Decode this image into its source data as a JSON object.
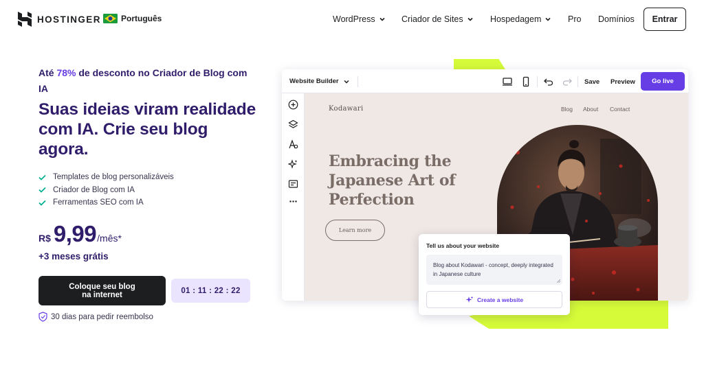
{
  "header": {
    "brand": "HOSTINGER",
    "language": "Português",
    "nav": [
      {
        "label": "WordPress",
        "dropdown": true
      },
      {
        "label": "Criador de Sites",
        "dropdown": true
      },
      {
        "label": "Hospedagem",
        "dropdown": true
      },
      {
        "label": "Pro",
        "dropdown": false
      },
      {
        "label": "Domínios",
        "dropdown": false
      }
    ],
    "login_label": "Entrar"
  },
  "hero": {
    "promo_prefix": "Até ",
    "promo_pct": "78%",
    "promo_suffix": " de desconto no Criador de Blog com IA",
    "headline": "Suas ideias viram realidade com IA. Crie seu blog agora.",
    "features": [
      "Templates de blog personalizáveis",
      "Criador de Blog com IA",
      "Ferramentas SEO com IA"
    ],
    "price": {
      "currency": "R$",
      "amount": "9,99",
      "period": "/mês*"
    },
    "bonus": "+3 meses grátis",
    "cta_label": "Coloque seu blog na internet",
    "timer": "01 : 11 : 22 : 22",
    "refund": "30 dias para pedir reembolso"
  },
  "builder": {
    "title": "Website Builder",
    "save_label": "Save",
    "preview_label": "Preview",
    "golive_label": "Go live",
    "site": {
      "logo": "Kodawari",
      "nav": [
        "Blog",
        "About",
        "Contact"
      ],
      "headline": "Embracing the Japanese Art of Perfection",
      "button_label": "Learn more"
    },
    "prompt": {
      "title": "Tell us about your website",
      "text": "Blog about Kodawari - concept, deeply integrated in Japanese culture",
      "button_label": "Create a website"
    }
  },
  "colors": {
    "brand_purple": "#673de6",
    "dark_purple": "#2f1c6a",
    "lime": "#d5fb39",
    "check_teal": "#00b090"
  },
  "icons": [
    "hostinger-logo-icon",
    "brazil-flag-icon",
    "chevron-down-icon",
    "check-icon",
    "shield-check-icon",
    "desktop-icon",
    "mobile-icon",
    "undo-icon",
    "redo-icon",
    "add-icon",
    "layers-icon",
    "styles-icon",
    "ai-sparkle-icon",
    "edit-text-icon",
    "more-icon"
  ]
}
